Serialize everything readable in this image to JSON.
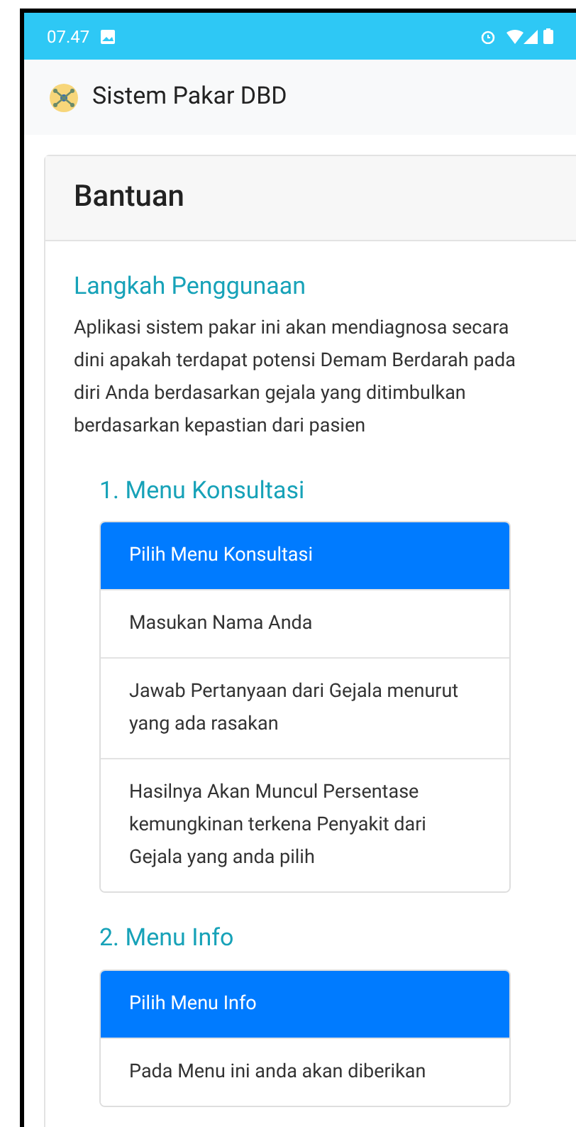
{
  "status_bar": {
    "time": "07.47"
  },
  "app_bar": {
    "title": "Sistem Pakar DBD"
  },
  "card": {
    "title": "Bantuan",
    "heading": "Langkah Penggunaan",
    "intro": "Aplikasi sistem pakar ini akan mendiagnosa secara dini apakah terdapat potensi Demam Berdarah pada diri Anda berdasarkan gejala yang ditimbulkan berdasarkan kepastian dari pasien",
    "sections": [
      {
        "title": "1. Menu Konsultasi",
        "items": [
          {
            "text": "Pilih Menu Konsultasi",
            "active": true
          },
          {
            "text": "Masukan Nama Anda",
            "active": false
          },
          {
            "text": "Jawab Pertanyaan dari Gejala menurut yang ada rasakan",
            "active": false
          },
          {
            "text": "Hasilnya Akan Muncul Persentase kemungkinan terkena Penyakit dari Gejala yang anda pilih",
            "active": false
          }
        ]
      },
      {
        "title": "2. Menu Info",
        "items": [
          {
            "text": "Pilih Menu Info",
            "active": true
          },
          {
            "text": "Pada Menu ini anda akan diberikan",
            "active": false
          }
        ]
      }
    ]
  }
}
